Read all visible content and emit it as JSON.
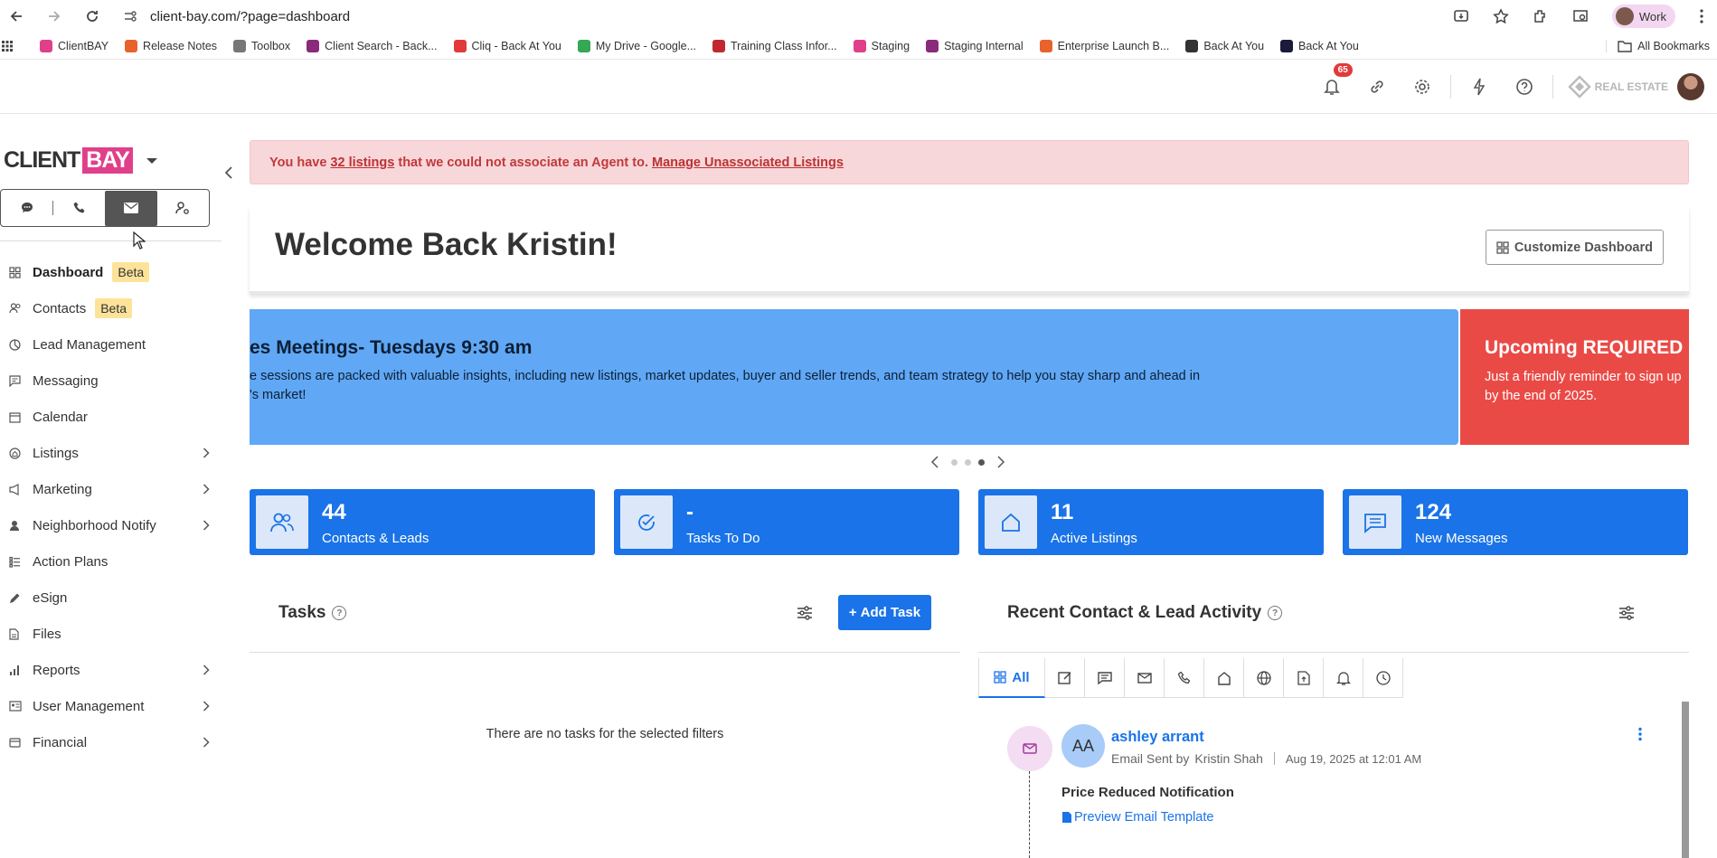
{
  "browser": {
    "url": "client-bay.com/?page=dashboard",
    "profile_label": "Work",
    "bookmarks": [
      {
        "label": "ClientBAY",
        "color": "#e0408a"
      },
      {
        "label": "Release Notes",
        "color": "#e8632b"
      },
      {
        "label": "Toolbox",
        "color": "#777777"
      },
      {
        "label": "Client Search - Back...",
        "color": "#8a2a7a"
      },
      {
        "label": "Cliq - Back At You",
        "color": "#e23a3a"
      },
      {
        "label": "My Drive - Google...",
        "color": "#34a853"
      },
      {
        "label": "Training Class Infor...",
        "color": "#c1272d"
      },
      {
        "label": "Staging",
        "color": "#e0408a"
      },
      {
        "label": "Staging Internal",
        "color": "#8a2a7a"
      },
      {
        "label": "Enterprise Launch B...",
        "color": "#e8632b"
      },
      {
        "label": "Back At You",
        "color": "#333333"
      },
      {
        "label": "Back At You",
        "color": "#1a1a3a"
      }
    ],
    "all_bookmarks": "All Bookmarks"
  },
  "header": {
    "notification_count": "65",
    "brand_text": "REAL ESTATE"
  },
  "sidebar": {
    "logo_client": "CLIENT",
    "logo_bay": "BAY",
    "items": [
      {
        "label": "Dashboard",
        "badge": "Beta",
        "icon": "grid-icon"
      },
      {
        "label": "Contacts",
        "badge": "Beta",
        "icon": "people-icon"
      },
      {
        "label": "Lead Management",
        "icon": "pie-icon"
      },
      {
        "label": "Messaging",
        "icon": "chat-icon"
      },
      {
        "label": "Calendar",
        "icon": "calendar-icon"
      },
      {
        "label": "Listings",
        "icon": "home-icon"
      },
      {
        "label": "Marketing",
        "icon": "megaphone-icon"
      },
      {
        "label": "Neighborhood Notify",
        "icon": "person-pin-icon"
      },
      {
        "label": "Action Plans",
        "icon": "list-icon"
      },
      {
        "label": "eSign",
        "icon": "pen-icon"
      },
      {
        "label": "Files",
        "icon": "file-icon"
      },
      {
        "label": "Reports",
        "icon": "bar-chart-icon"
      },
      {
        "label": "User Management",
        "icon": "id-card-icon"
      },
      {
        "label": "Financial",
        "icon": "bank-icon"
      }
    ]
  },
  "alert": {
    "prefix": "You have ",
    "link_count": "32 listings",
    "middle": " that we could not associate an Agent to. ",
    "link_manage": "Manage Unassociated Listings"
  },
  "welcome": {
    "title": "Welcome Back Kristin!",
    "customize_label": "Customize Dashboard"
  },
  "carousel": {
    "slide1_title": "es Meetings- Tuesdays 9:30 am",
    "slide1_line1": "e sessions are packed with valuable insights, including new listings, market updates, buyer and seller trends, and team strategy to help you stay sharp and ahead in",
    "slide1_line2": "'s market!",
    "slide2_title": "Upcoming REQUIRED C",
    "slide2_line1": "Just a friendly reminder to sign up",
    "slide2_line2": "by the end of 2025.",
    "slide1_color": "#60a8f5",
    "slide2_color": "#ea4a46"
  },
  "stats": [
    {
      "value": "44",
      "label": "Contacts & Leads",
      "icon": "people-icon"
    },
    {
      "value": "-",
      "label": "Tasks To Do",
      "icon": "check-circle-icon"
    },
    {
      "value": "11",
      "label": "Active Listings",
      "icon": "house-icon"
    },
    {
      "value": "124",
      "label": "New Messages",
      "icon": "message-icon"
    }
  ],
  "tasks": {
    "title": "Tasks",
    "help": "?",
    "add_label": "Add Task",
    "empty_text": "There are no tasks for the selected filters"
  },
  "activity": {
    "title": "Recent Contact & Lead Activity",
    "help": "?",
    "all_tab": "All",
    "item": {
      "initials": "AA",
      "name": "ashley arrant",
      "action": "Email Sent by",
      "agent": "Kristin Shah",
      "date": "Aug 19, 2025 at 12:01 AM",
      "subject": "Price Reduced Notification",
      "preview": "Preview Email Template"
    }
  },
  "colors": {
    "accent": "#1a73e8",
    "alert_bg": "#f8d7da",
    "alert_text": "#c13a3a",
    "beta": "#fde39a"
  }
}
